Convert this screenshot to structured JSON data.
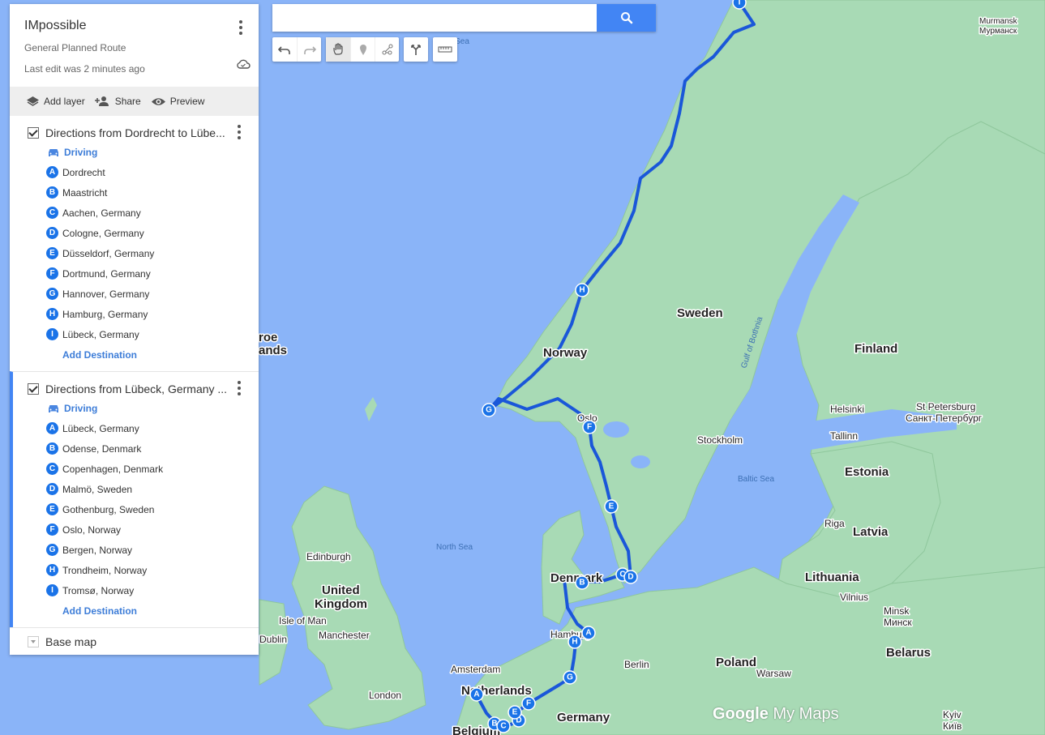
{
  "panel": {
    "title": "IMpossible",
    "subtitle": "General Planned Route",
    "last_edit": "Last edit was 2 minutes ago",
    "actions": {
      "add_layer": "Add layer",
      "share": "Share",
      "preview": "Preview"
    },
    "layers": [
      {
        "title": "Directions from Dordrecht to Lübe...",
        "mode": "Driving",
        "stops": [
          {
            "letter": "A",
            "name": "Dordrecht"
          },
          {
            "letter": "B",
            "name": "Maastricht"
          },
          {
            "letter": "C",
            "name": "Aachen, Germany"
          },
          {
            "letter": "D",
            "name": "Cologne, Germany"
          },
          {
            "letter": "E",
            "name": "Düsseldorf, Germany"
          },
          {
            "letter": "F",
            "name": "Dortmund, Germany"
          },
          {
            "letter": "G",
            "name": "Hannover, Germany"
          },
          {
            "letter": "H",
            "name": "Hamburg, Germany"
          },
          {
            "letter": "I",
            "name": "Lübeck, Germany"
          }
        ],
        "add_destination": "Add Destination"
      },
      {
        "title": "Directions from Lübeck, Germany ...",
        "mode": "Driving",
        "stops": [
          {
            "letter": "A",
            "name": "Lübeck, Germany"
          },
          {
            "letter": "B",
            "name": "Odense, Denmark"
          },
          {
            "letter": "C",
            "name": "Copenhagen, Denmark"
          },
          {
            "letter": "D",
            "name": "Malmö, Sweden"
          },
          {
            "letter": "E",
            "name": "Gothenburg, Sweden"
          },
          {
            "letter": "F",
            "name": "Oslo, Norway"
          },
          {
            "letter": "G",
            "name": "Bergen, Norway"
          },
          {
            "letter": "H",
            "name": "Trondheim, Norway"
          },
          {
            "letter": "I",
            "name": "Tromsø, Norway"
          }
        ],
        "add_destination": "Add Destination"
      }
    ],
    "base_map": "Base map"
  },
  "search": {
    "value": ""
  },
  "map": {
    "labels": {
      "sweden": "Sweden",
      "norway": "Norway",
      "finland": "Finland",
      "estonia": "Estonia",
      "latvia": "Latvia",
      "lithuania": "Lithuania",
      "belarus": "Belarus",
      "poland": "Poland",
      "germany": "Germany",
      "denmark": "Denmark",
      "netherlands": "Netherlands",
      "belgium": "Belgium",
      "uk1": "United",
      "uk2": "Kingdom",
      "isle_of_man": "Isle of Man",
      "faroe1": "roe",
      "faroe2": "ands",
      "oslo": "Oslo",
      "stockholm": "Stockholm",
      "helsinki": "Helsinki",
      "tallinn": "Tallinn",
      "riga": "Riga",
      "vilnius": "Vilnius",
      "minsk1": "Minsk",
      "minsk2": "Минск",
      "stp1": "St Petersburg",
      "stp2": "Санкт-Петербург",
      "murmansk1": "Murmansk",
      "murmansk2": "Мурманск",
      "warsaw": "Warsaw",
      "berlin": "Berlin",
      "hamburg": "Hamburg",
      "amsterdam": "Amsterdam",
      "london": "London",
      "manchester": "Manchester",
      "dublin": "Dublin",
      "edinburgh": "Edinburgh",
      "kyiv1": "Kyiv",
      "kyiv2": "Київ",
      "north_sea": "North Sea",
      "baltic_sea": "Baltic Sea",
      "gulf_bothnia": "Gulf of Bothnia",
      "norw_sea": "ian Sea"
    },
    "logo_google": "Google",
    "logo_mymaps": "My Maps"
  }
}
